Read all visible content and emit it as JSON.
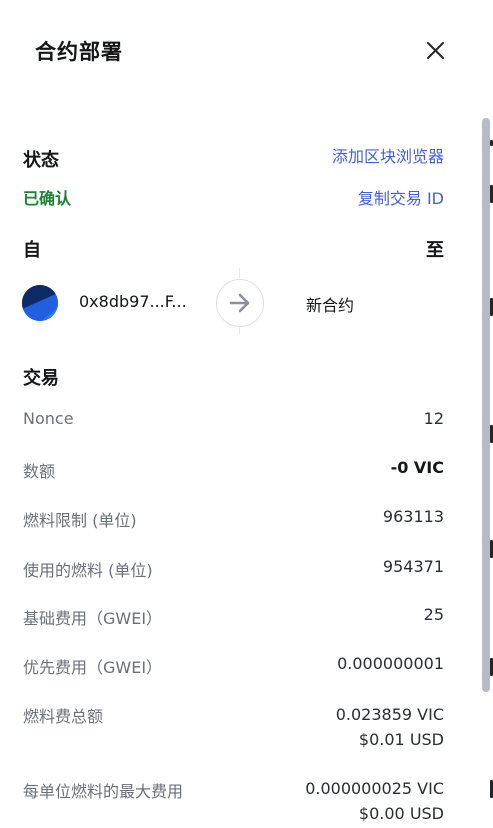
{
  "dialog": {
    "title": "合约部署"
  },
  "status": {
    "heading": "状态",
    "explorer_link": "添加区块浏览器",
    "value": "已确认",
    "copy_link": "复制交易 ID"
  },
  "parties": {
    "from_heading": "自",
    "to_heading": "至",
    "from_address": "0x8db97...F...",
    "to_label": "新合约"
  },
  "transaction": {
    "heading": "交易",
    "rows": [
      {
        "label": "Nonce",
        "value": "12"
      },
      {
        "label": "数额",
        "value": "-0 VIC"
      },
      {
        "label": "燃料限制 (单位)",
        "value": "963113"
      },
      {
        "label": "使用的燃料 (单位)",
        "value": "954371"
      },
      {
        "label": "基础费用（GWEI）",
        "value": "25"
      },
      {
        "label": "优先费用（GWEI）",
        "value": "0.000000001"
      },
      {
        "label": "燃料费总额",
        "value": "0.023859 VIC",
        "value2": "$0.01 USD"
      },
      {
        "label": "每单位燃料的最大费用",
        "value": "0.000000025 VIC",
        "value2": "$0.00 USD"
      }
    ]
  },
  "colors": {
    "link": "#4460d8",
    "confirmed": "#1c8234",
    "avatar_primary": "#1f5fe0",
    "avatar_secondary": "#0d2a66"
  },
  "icons": {
    "close": "close-icon",
    "arrow": "arrow-right-icon",
    "avatar": "account-avatar-icon"
  }
}
